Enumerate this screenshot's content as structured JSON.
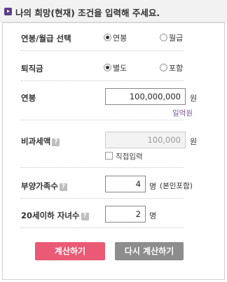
{
  "header": {
    "title": "나의 희망(현재) 조건을 입력해 주세요."
  },
  "salary_type": {
    "label": "연봉/월급 선택",
    "options": [
      "연봉",
      "월급"
    ],
    "selected": "연봉"
  },
  "severance": {
    "label": "퇴직금",
    "options": [
      "별도",
      "포함"
    ],
    "selected": "별도"
  },
  "annual_salary": {
    "label": "연봉",
    "value": "100,000,000",
    "unit": "원",
    "hint": "일억원"
  },
  "nontaxable": {
    "label": "비과세액",
    "help_icon": "?",
    "value": "100,000",
    "unit": "원",
    "checkbox_label": "직접입력",
    "checked": false
  },
  "dependents": {
    "label": "부양가족수",
    "help_icon": "?",
    "value": "4",
    "unit": "명",
    "note": "(본인포함)"
  },
  "children": {
    "label": "20세이하 자녀수",
    "help_icon": "?",
    "value": "2",
    "unit": "명"
  },
  "buttons": {
    "calculate": "계산하기",
    "recalculate": "다시 계산하기"
  },
  "colors": {
    "accent": "#5c3f86",
    "hint": "#7456a0",
    "calc_button": "#ea5a74",
    "reset_button": "#8d8d8d"
  }
}
